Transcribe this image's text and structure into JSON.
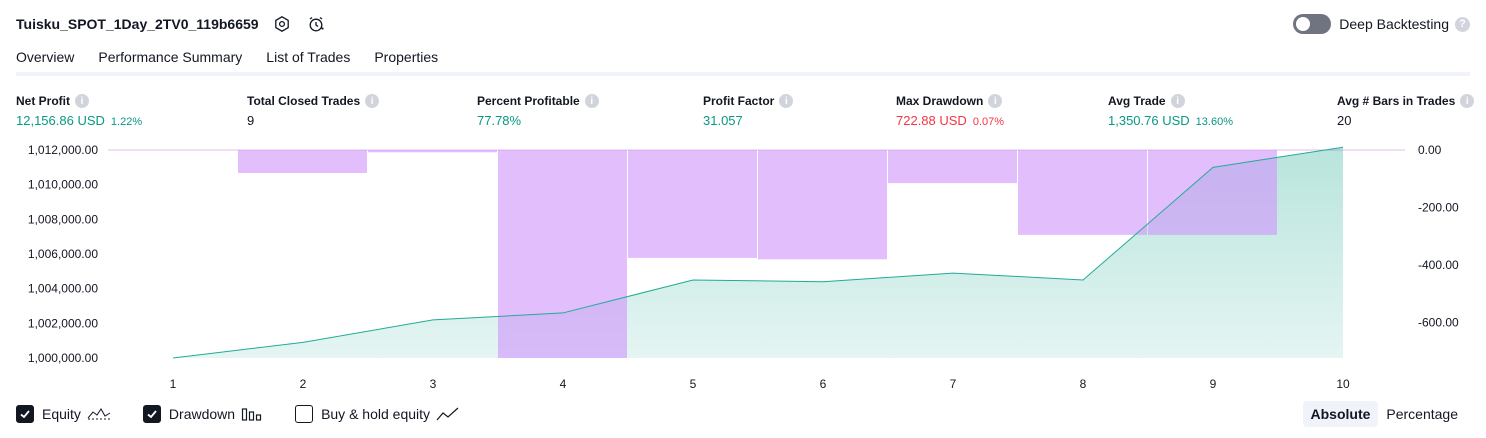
{
  "header": {
    "title": "Tuisku_SPOT_1Day_2TV0_119b6659",
    "deep_backtesting_label": "Deep Backtesting",
    "help_glyph": "?"
  },
  "tabs": [
    {
      "label": "Overview",
      "active": true
    },
    {
      "label": "Performance Summary",
      "active": false
    },
    {
      "label": "List of Trades",
      "active": false
    },
    {
      "label": "Properties",
      "active": false
    }
  ],
  "metrics": [
    {
      "label": "Net Profit",
      "value": "12,156.86 USD",
      "pct": "1.22%",
      "tone": "green"
    },
    {
      "label": "Total Closed Trades",
      "value": "9",
      "pct": "",
      "tone": "neutral"
    },
    {
      "label": "Percent Profitable",
      "value": "77.78%",
      "pct": "",
      "tone": "green"
    },
    {
      "label": "Profit Factor",
      "value": "31.057",
      "pct": "",
      "tone": "green"
    },
    {
      "label": "Max Drawdown",
      "value": "722.88 USD",
      "pct": "0.07%",
      "tone": "red"
    },
    {
      "label": "Avg Trade",
      "value": "1,350.76 USD",
      "pct": "13.60%",
      "tone": "green"
    },
    {
      "label": "Avg # Bars in Trades",
      "value": "20",
      "pct": "",
      "tone": "neutral"
    }
  ],
  "info_glyph": "i",
  "chart_data": {
    "type": "line+bar",
    "x": [
      1,
      2,
      3,
      4,
      5,
      6,
      7,
      8,
      9,
      10
    ],
    "equity": {
      "values": [
        1000000,
        1000900,
        1002200,
        1002600,
        1004500,
        1004400,
        1004900,
        1004500,
        1011000,
        1012156.86
      ],
      "ylim": [
        1000000,
        1012000
      ],
      "ticks": [
        "1,012,000.00",
        "1,010,000.00",
        "1,008,000.00",
        "1,006,000.00",
        "1,004,000.00",
        "1,002,000.00",
        "1,000,000.00"
      ],
      "tick_values": [
        1012000,
        1010000,
        1008000,
        1006000,
        1004000,
        1002000,
        1000000
      ]
    },
    "drawdown": {
      "values": [
        0,
        -80,
        -8,
        -722.88,
        -375,
        -380,
        -115,
        -295,
        -295,
        0
      ],
      "ylim": [
        -722.88,
        0
      ],
      "ticks": [
        "0.00",
        "-200.00",
        "-400.00",
        "-600.00"
      ],
      "tick_values": [
        0,
        -200,
        -400,
        -600
      ]
    },
    "x_ticks": [
      "1",
      "2",
      "3",
      "4",
      "5",
      "6",
      "7",
      "8",
      "9",
      "10"
    ],
    "colors": {
      "equity_line": "#22ab94",
      "equity_fill": "#22ab94",
      "drawdown": "#ce93fc",
      "zero_line": "#e1bee7"
    }
  },
  "legend": {
    "equity_label": "Equity",
    "drawdown_label": "Drawdown",
    "buyhold_label": "Buy & hold equity"
  },
  "modes": {
    "absolute": "Absolute",
    "percentage": "Percentage"
  }
}
